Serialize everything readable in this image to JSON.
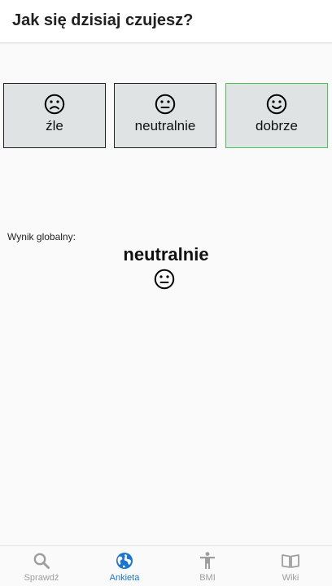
{
  "header": {
    "title": "Jak się dzisiaj czujesz?"
  },
  "moods": [
    {
      "label": "źle",
      "icon": "sad-face-icon",
      "selected": false
    },
    {
      "label": "neutralnie",
      "icon": "neutral-face-icon",
      "selected": false
    },
    {
      "label": "dobrze",
      "icon": "happy-face-icon",
      "selected": true
    }
  ],
  "global": {
    "label": "Wynik globalny:",
    "result": "neutralnie",
    "icon": "neutral-face-icon"
  },
  "bottom_nav": [
    {
      "label": "Sprawdź",
      "icon": "search-icon",
      "active": false
    },
    {
      "label": "Ankieta",
      "icon": "globe-icon",
      "active": true
    },
    {
      "label": "BMI",
      "icon": "person-icon",
      "active": false
    },
    {
      "label": "Wiki",
      "icon": "book-icon",
      "active": false
    }
  ],
  "colors": {
    "active": "#1976d2",
    "inactive": "#9e9e9e",
    "selected_border": "#49c45a",
    "button_bg": "#e0e3e3"
  }
}
